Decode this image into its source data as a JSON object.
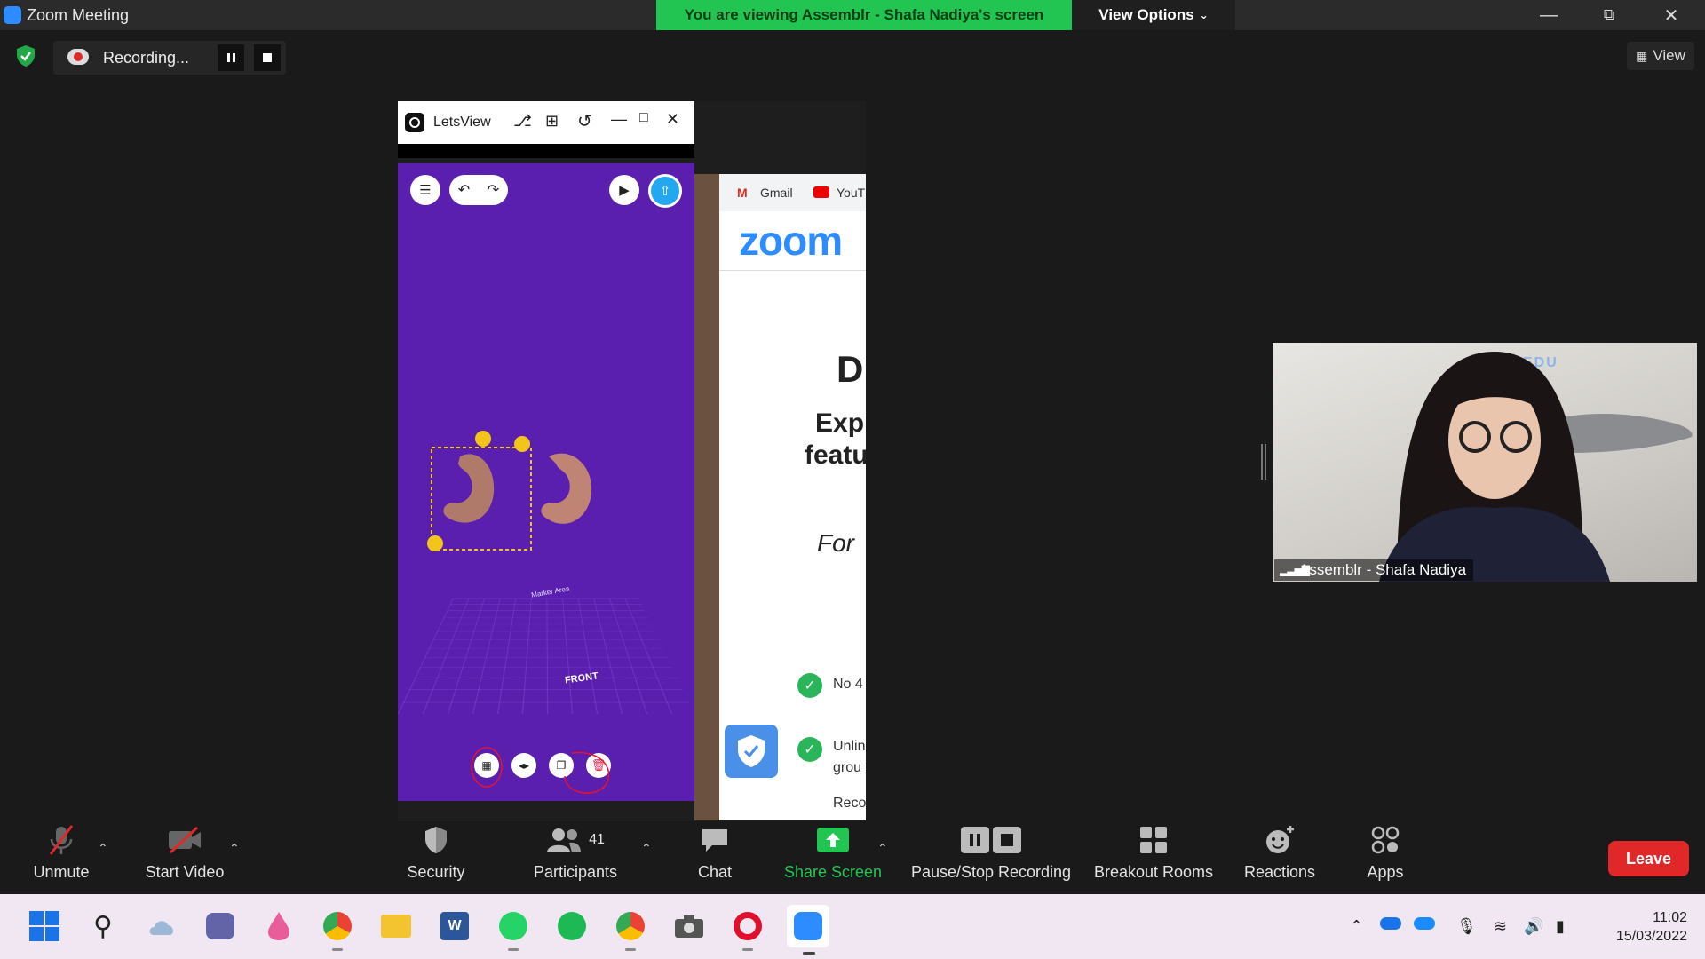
{
  "window": {
    "title": "Zoom Meeting",
    "share_banner": "You are viewing Assemblr - Shafa Nadiya's screen",
    "view_options": "View Options"
  },
  "recording": {
    "status": "Recording..."
  },
  "view_button": "View",
  "shared_screen": {
    "app_title": "LetsView",
    "browser_tabs": [
      "Gmail",
      "YouT"
    ],
    "zoom_logo_text": "zoom",
    "page_heading_fragment": "D",
    "page_text_1": "Exp",
    "page_text_2": "featu",
    "page_italic": "For",
    "list_items": [
      "No 4",
      "Unlin",
      "grou",
      "Reco"
    ],
    "marker_area": "Marker Area",
    "front_label": "FRONT"
  },
  "participant": {
    "name": "Assemblr - Shafa Nadiya",
    "wall_text": "EDU"
  },
  "toolbar": {
    "unmute": "Unmute",
    "start_video": "Start Video",
    "security": "Security",
    "participants": "Participants",
    "participants_count": "41",
    "chat": "Chat",
    "share_screen": "Share Screen",
    "pause_stop_recording": "Pause/Stop Recording",
    "breakout_rooms": "Breakout Rooms",
    "reactions": "Reactions",
    "apps": "Apps",
    "leave": "Leave"
  },
  "taskbar": {
    "time": "11:02",
    "date": "15/03/2022"
  },
  "colors": {
    "share_banner": "#23c552",
    "leave": "#e02828",
    "phone_bg": "#5a1fae",
    "zoom_blue": "#2d8cff"
  }
}
